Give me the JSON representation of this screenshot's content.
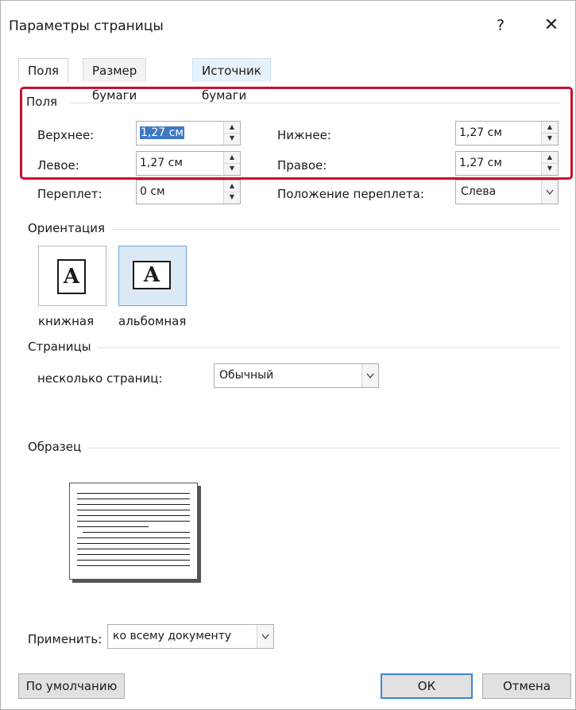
{
  "window": {
    "title": "Параметры страницы",
    "help": "?",
    "close": "✕"
  },
  "tabs": [
    {
      "label": "Поля"
    },
    {
      "label": "Размер бумаги"
    },
    {
      "label": "Источник бумаги"
    }
  ],
  "margins": {
    "section": "Поля",
    "top": {
      "label": "Верхнее:",
      "value": "1,27 см"
    },
    "bottom": {
      "label": "Нижнее:",
      "value": "1,27 см"
    },
    "left": {
      "label": "Левое:",
      "value": "1,27 см"
    },
    "right": {
      "label": "Правое:",
      "value": "1,27 см"
    },
    "gutter": {
      "label": "Переплет:",
      "value": "0 см"
    },
    "gutter_pos": {
      "label": "Положение переплета:",
      "value": "Слева"
    }
  },
  "orientation": {
    "section": "Ориентация",
    "portrait": {
      "label": "книжная",
      "glyph": "A"
    },
    "landscape": {
      "label": "альбомная",
      "glyph": "A"
    }
  },
  "pages": {
    "section": "Страницы",
    "multiple_label": "несколько страниц:",
    "multiple_value": "Обычный"
  },
  "preview": {
    "section": "Образец"
  },
  "apply": {
    "label": "Применить:",
    "value": "ко всему документу"
  },
  "buttons": {
    "default": "По умолчанию",
    "ok": "ОК",
    "cancel": "Отмена"
  },
  "colors": {
    "highlight_box": "#c8102e",
    "selection": "#3f79c6",
    "default_button_border": "#3c87d1"
  }
}
